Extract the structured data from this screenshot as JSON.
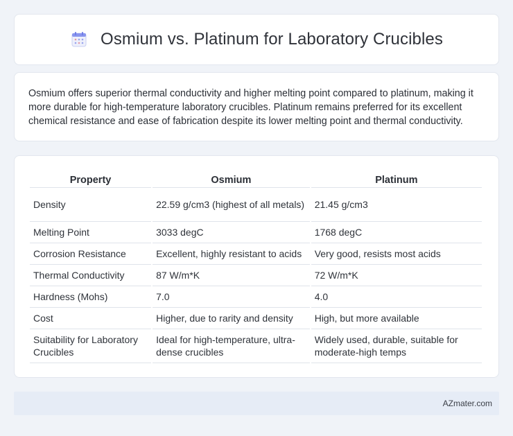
{
  "header": {
    "title": "Osmium vs. Platinum for Laboratory Crucibles",
    "icon": "calendar-icon"
  },
  "summary": {
    "text": "Osmium offers superior thermal conductivity and higher melting point compared to platinum, making it more durable for high-temperature laboratory crucibles. Platinum remains preferred for its excellent chemical resistance and ease of fabrication despite its lower melting point and thermal conductivity."
  },
  "table": {
    "headers": [
      "Property",
      "Osmium",
      "Platinum"
    ],
    "rows": [
      [
        "Density",
        "22.59 g/cm3 (highest of all metals)",
        "21.45 g/cm3"
      ],
      [
        "Melting Point",
        "3033 degC",
        "1768 degC"
      ],
      [
        "Corrosion Resistance",
        "Excellent, highly resistant to acids",
        "Very good, resists most acids"
      ],
      [
        "Thermal Conductivity",
        "87 W/m*K",
        "72 W/m*K"
      ],
      [
        "Hardness (Mohs)",
        "7.0",
        "4.0"
      ],
      [
        "Cost",
        "Higher, due to rarity and density",
        "High, but more available"
      ],
      [
        "Suitability for Laboratory Crucibles",
        "Ideal for high-temperature, ultra-dense crucibles",
        "Widely used, durable, suitable for moderate-high temps"
      ]
    ]
  },
  "footer": {
    "brand": "AZmater.com"
  },
  "colors": {
    "background": "#f0f3f8",
    "card": "#ffffff",
    "footer": "#e6ecf6",
    "icon_accent": "#7b8cf0"
  }
}
